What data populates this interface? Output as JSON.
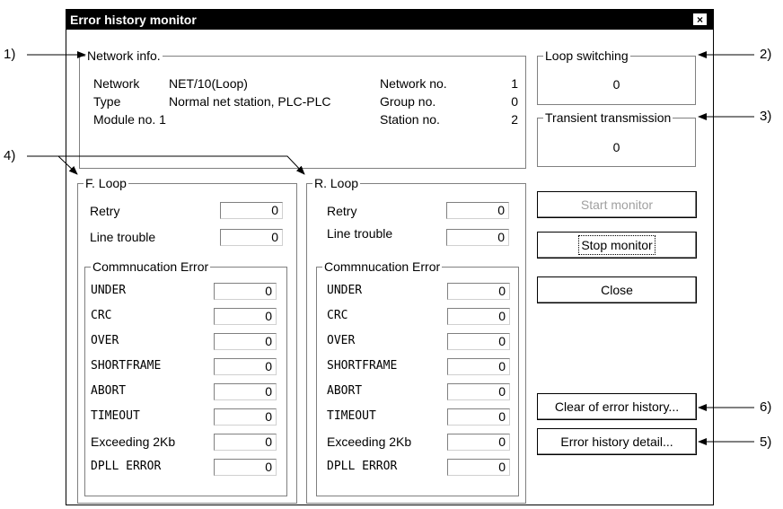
{
  "window": {
    "title": "Error history monitor",
    "close_glyph": "×"
  },
  "network_info": {
    "label": "Network info.",
    "network_label": "Network",
    "network_value": "NET/10(Loop)",
    "type_label": "Type",
    "type_value": "Normal net station, PLC-PLC",
    "module_no": "Module no. 1",
    "network_no_label": "Network no.",
    "network_no_value": "1",
    "group_no_label": "Group no.",
    "group_no_value": "0",
    "station_no_label": "Station no.",
    "station_no_value": "2"
  },
  "loop_switching": {
    "label": "Loop switching",
    "value": "0"
  },
  "transient_transmission": {
    "label": "Transient transmission",
    "value": "0"
  },
  "f_loop": {
    "label": "F. Loop",
    "retry_label": "Retry",
    "retry_value": "0",
    "line_trouble_label": "Line trouble",
    "line_trouble_value": "0",
    "comm_label": "Commnucation Error",
    "errors": [
      {
        "label": "UNDER",
        "value": "0"
      },
      {
        "label": "CRC",
        "value": "0"
      },
      {
        "label": "OVER",
        "value": "0"
      },
      {
        "label": "SHORTFRAME",
        "value": "0"
      },
      {
        "label": "ABORT",
        "value": "0"
      },
      {
        "label": "TIMEOUT",
        "value": "0"
      },
      {
        "label": "Exceeding 2Kb",
        "value": "0"
      },
      {
        "label": "DPLL ERROR",
        "value": "0"
      }
    ]
  },
  "r_loop": {
    "label": "R. Loop",
    "retry_label": "Retry",
    "retry_value": "0",
    "line_trouble_label": "Line trouble",
    "line_trouble_value": "0",
    "comm_label": "Commnucation Error",
    "errors": [
      {
        "label": "UNDER",
        "value": "0"
      },
      {
        "label": "CRC",
        "value": "0"
      },
      {
        "label": "OVER",
        "value": "0"
      },
      {
        "label": "SHORTFRAME",
        "value": "0"
      },
      {
        "label": "ABORT",
        "value": "0"
      },
      {
        "label": "TIMEOUT",
        "value": "0"
      },
      {
        "label": "Exceeding 2Kb",
        "value": "0"
      },
      {
        "label": "DPLL ERROR",
        "value": "0"
      }
    ]
  },
  "buttons": {
    "start_monitor": "Start monitor",
    "stop_monitor": "Stop monitor",
    "close": "Close",
    "error_history_detail": "Error history detail...",
    "clear_error_history": "Clear of error history..."
  },
  "callouts": [
    "1)",
    "2)",
    "3)",
    "4)",
    "5)",
    "6)"
  ]
}
